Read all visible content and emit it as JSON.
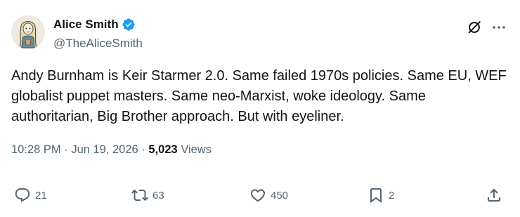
{
  "author": {
    "display_name": "Alice Smith",
    "handle": "@TheAliceSmith",
    "verified": true
  },
  "tweet": {
    "text": "Andy Burnham is Keir Starmer 2.0. Same failed 1970s policies. Same EU, WEF globalist puppet masters. Same neo-Marxist, woke ideology. Same authoritarian, Big Brother approach. But with eyeliner."
  },
  "meta": {
    "time": "10:28 PM",
    "separator": "·",
    "date": "Jun 19, 2026",
    "views_count": "5,023",
    "views_label": "Views"
  },
  "actions": {
    "replies": "21",
    "retweets": "63",
    "likes": "450",
    "bookmarks": "2"
  },
  "icons": {
    "verified": "verified-badge-icon",
    "grok": "grok-icon",
    "more": "more-icon",
    "reply": "reply-icon",
    "retweet": "retweet-icon",
    "like": "heart-icon",
    "bookmark": "bookmark-icon",
    "share": "share-icon"
  },
  "colors": {
    "text": "#0f1419",
    "secondary": "#536471",
    "verified_blue": "#1d9bf0"
  }
}
